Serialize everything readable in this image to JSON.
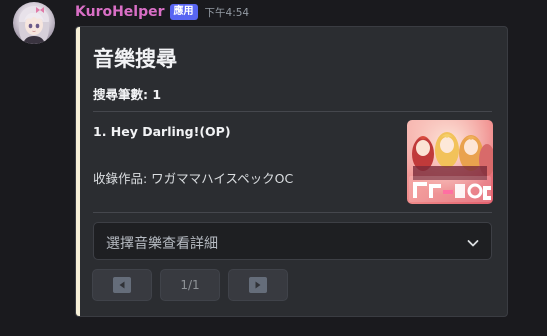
{
  "message": {
    "username": "KuroHelper",
    "badge": "應用",
    "timestamp": "下午4:54",
    "avatar_icon": "avatar-image"
  },
  "embed": {
    "accent_color": "#f6f0d8",
    "title": "音樂搜尋",
    "search_count_label": "搜尋筆數: 1",
    "results": [
      {
        "title": "1. Hey Darling!(OP)",
        "work": "收錄作品: ワガママハイスペックOC",
        "thumbnail_icon": "album-cover-image"
      }
    ]
  },
  "components": {
    "select_placeholder": "選擇音樂查看詳細",
    "select_icon": "chevron-down-icon",
    "prev_icon": "arrow-left-icon",
    "page_label": "1/1",
    "next_icon": "arrow-right-icon"
  }
}
